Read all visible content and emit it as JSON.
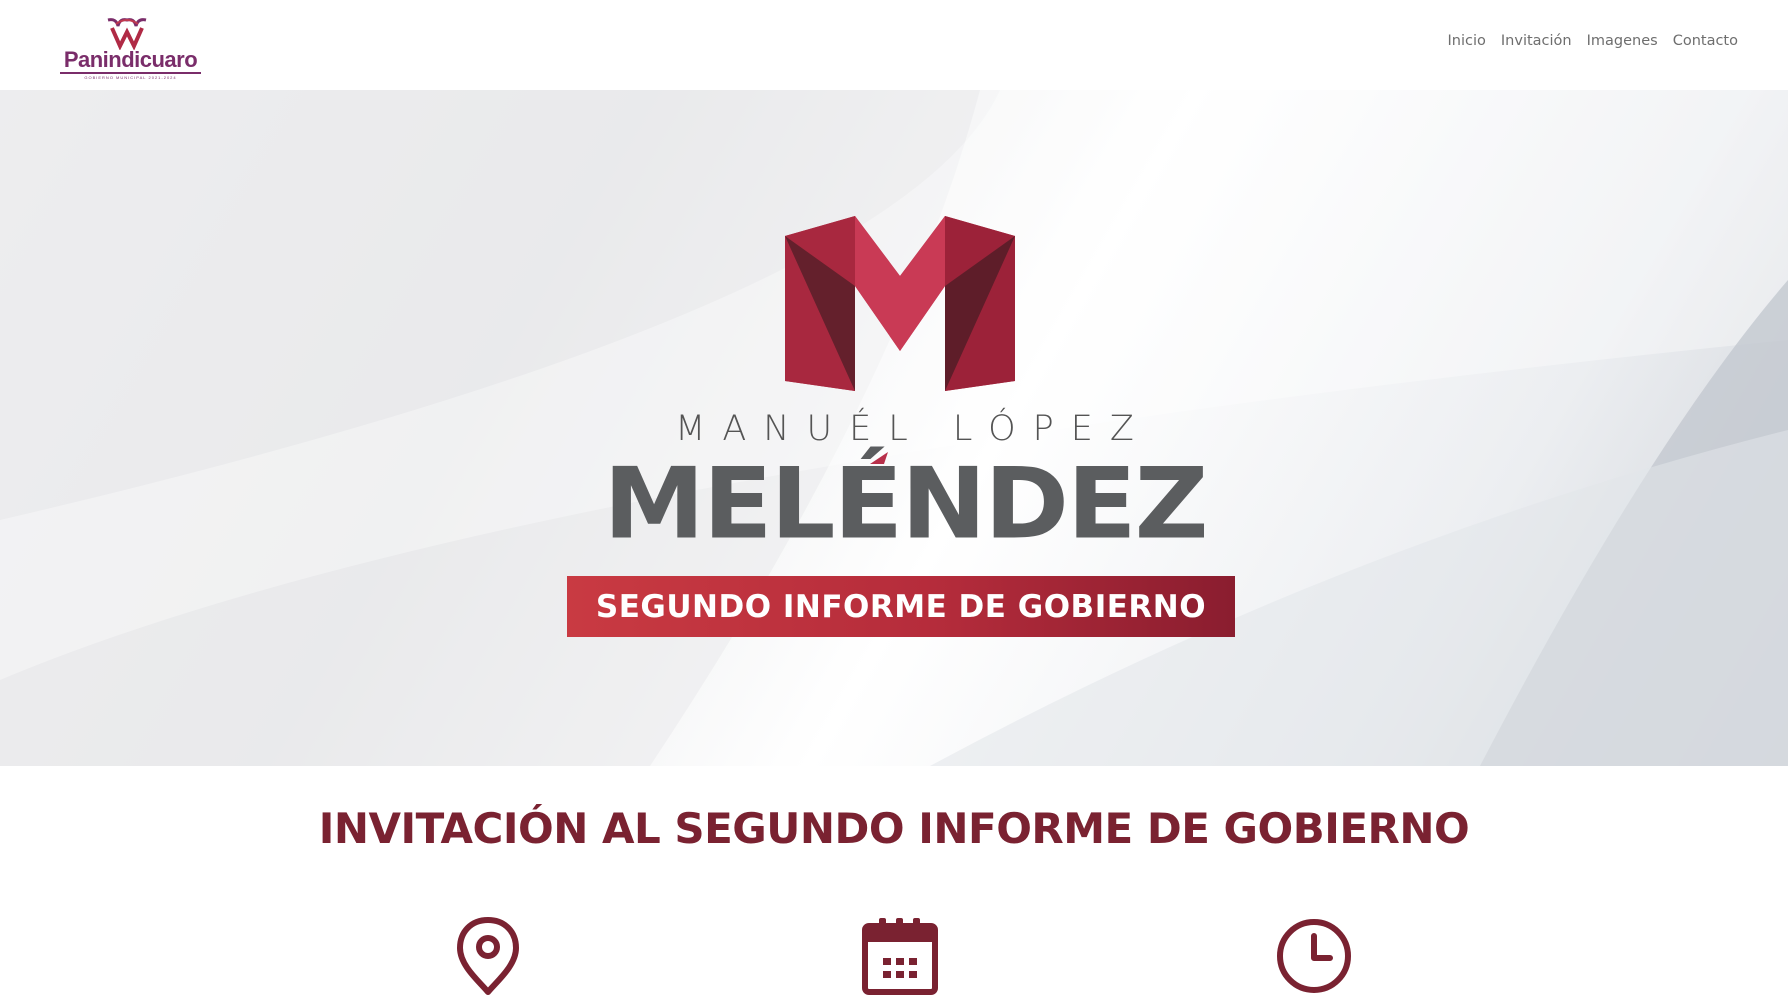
{
  "header": {
    "logo": {
      "name": "Panindicuaro",
      "subtitle": "GOBIERNO MUNICIPAL 2021-2024"
    },
    "nav": [
      {
        "label": "Inicio"
      },
      {
        "label": "Invitación"
      },
      {
        "label": "Imagenes"
      },
      {
        "label": "Contacto"
      }
    ]
  },
  "hero": {
    "first_name": "MANUÉL LÓPEZ",
    "surname": "MELÉNDEZ",
    "banner": "SEGUNDO INFORME DE GOBIERNO"
  },
  "invitation": {
    "title": "INVITACIÓN AL SEGUNDO INFORME DE GOBIERNO",
    "icons": [
      "location-pin-icon",
      "calendar-icon",
      "clock-icon"
    ]
  },
  "colors": {
    "brand_purple": "#7a2d6a",
    "brand_red": "#b52c3b",
    "title_red": "#7a2231",
    "surname_gray": "#5b5d5f"
  }
}
